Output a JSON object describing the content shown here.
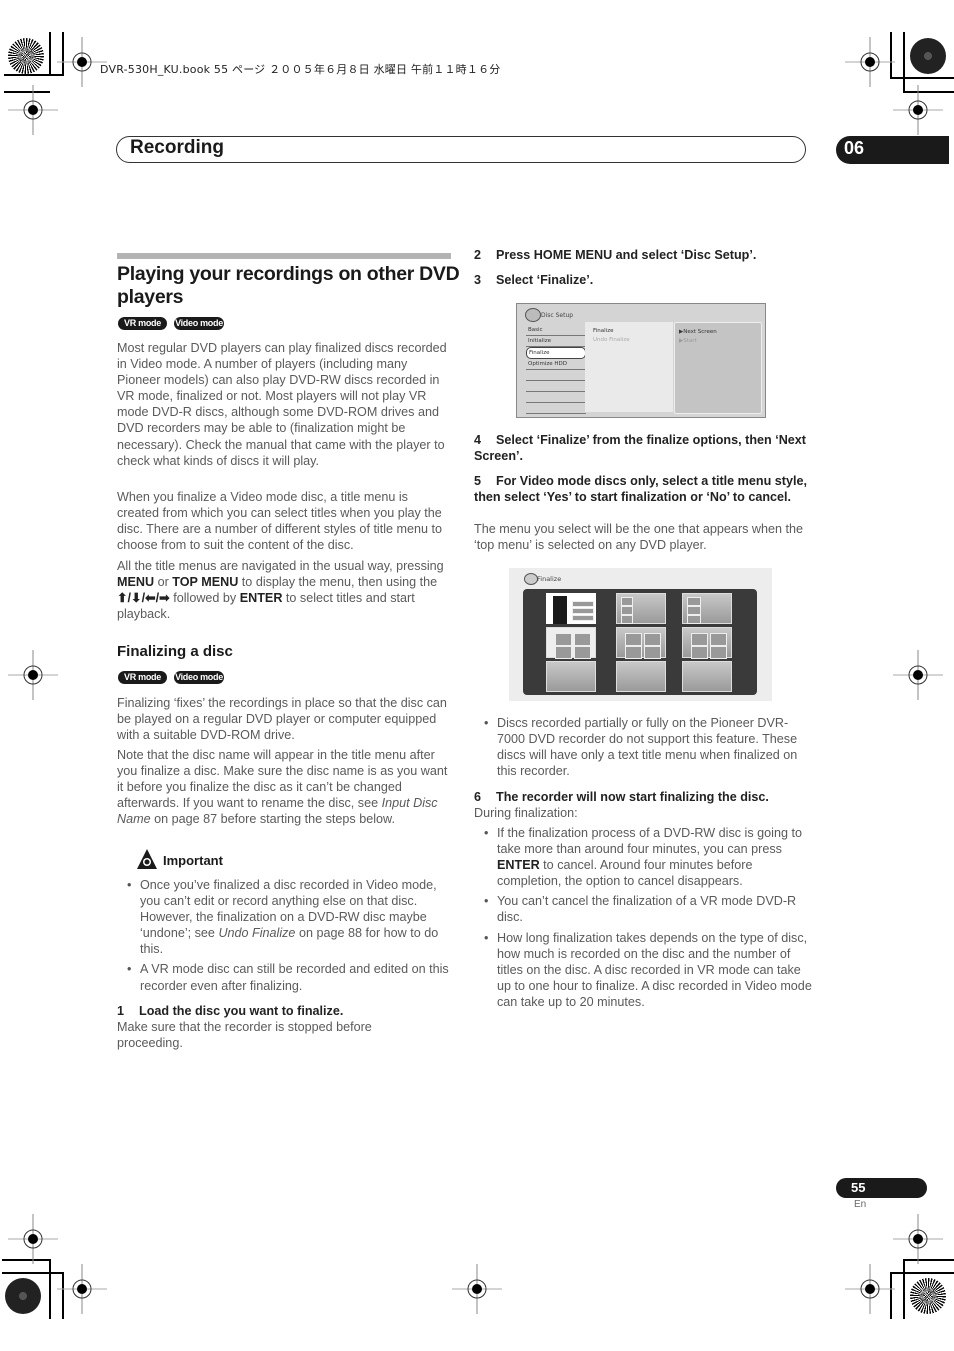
{
  "print_meta": "DVR-530H_KU.book  55 ページ  ２００５年６月８日  水曜日  午前１１時１６分",
  "header": {
    "section_title": "Recording",
    "chapter_number": "06"
  },
  "left_column": {
    "heading": "Playing your recordings on other DVD players",
    "badges": [
      "VR mode",
      "Video mode"
    ],
    "paragraphs": [
      "Most regular DVD players can play finalized discs recorded in Video mode. A number of players (including many Pioneer models) can also play DVD-RW discs recorded in VR mode, finalized or not. Most players will not play VR mode DVD-R discs, although some DVD-ROM drives and DVD recorders may be able to (finalization might be necessary). Check the manual that came with the player to check what kinds of discs it will play.",
      "When you finalize a Video mode disc, a title menu is created from which you can select titles when you play the disc. There are a number of different styles of title menu to choose from to suit the content of the disc."
    ],
    "nav_paragraph": {
      "t1": "All the title menus are navigated in the usual way, pressing ",
      "k1": "MENU",
      "t2": " or ",
      "k2": "TOP MENU",
      "t3": " to display the menu, then using the ",
      "k3": "⬆/⬇/⬅/➡",
      "t4": " followed by ",
      "k4": "ENTER",
      "t5": " to select titles and start playback."
    },
    "subheading": "Finalizing a disc",
    "sub_badges": [
      "VR mode",
      "Video mode"
    ],
    "finalize_paragraph": "Finalizing ‘fixes’ the recordings in place so that the disc can be played on a regular DVD player or computer equipped with a suitable DVD-ROM drive.",
    "note_paragraph": {
      "t1": "Note that the disc name will appear in the title menu after you finalize a disc. Make sure the disc name is as you want it before you finalize the disc as it can’t be changed afterwards. If you want to rename the disc, see ",
      "ref": "Input Disc Name",
      "t2": " on page 87 before starting the steps below."
    },
    "important": {
      "title": "Important",
      "items": [
        {
          "t1": "Once you’ve finalized a disc recorded in Video mode, you can’t edit or record anything else on that disc. However, the finalization on a DVD-RW disc maybe ‘undone’; see ",
          "ref": "Undo Finalize",
          "t2": " on page 88 for how to do this."
        },
        {
          "t1": "A VR mode disc can still be recorded and edited on this recorder even after finalizing."
        }
      ]
    },
    "step1": {
      "num": "1",
      "text": "Load the disc you want to finalize.",
      "body": "Make sure that the recorder is stopped before proceeding."
    }
  },
  "right_column": {
    "step2": {
      "num": "2",
      "text": "Press HOME MENU and select ‘Disc Setup’."
    },
    "step3": {
      "num": "3",
      "text": "Select ‘Finalize’."
    },
    "disc_setup_screen": {
      "title": "Disc Setup",
      "menu": [
        "Basic",
        "Initialize",
        "Finalize",
        "Optimize HDD",
        "",
        "",
        "",
        ""
      ],
      "selected": "Finalize",
      "options": [
        "Finalize",
        "Undo Finalize"
      ],
      "actions": [
        "▶Next Screen",
        "▶Start"
      ]
    },
    "step4": {
      "num": "4",
      "text": "Select ‘Finalize’ from the finalize options, then ‘Next Screen’."
    },
    "step5": {
      "num": "5",
      "text": "For Video mode discs only, select a title menu style, then select ‘Yes’ to start finalization or ‘No’ to cancel.",
      "body": "The menu you select will be the one that appears when the ‘top menu’ is selected on any DVD player."
    },
    "finalize_screen": {
      "title": "Finalize",
      "thumbnail_count": 9,
      "selected_index": 0
    },
    "note_bullets": [
      "Discs recorded partially or fully on the Pioneer DVR-7000 DVD recorder do not support this feature. These discs will have only a text title menu when finalized on this recorder."
    ],
    "step6": {
      "num": "6",
      "text": "The recorder will now start finalizing the disc.",
      "body": "During finalization:"
    },
    "step6_bullets": [
      {
        "t1": "If the finalization process of a DVD-RW disc is going to take more than around four minutes, you can press ",
        "k": "ENTER",
        "t2": " to cancel. Around four minutes before completion, the option to cancel disappears."
      },
      {
        "t1": "You can’t cancel the finalization of a VR mode DVD-R disc."
      },
      {
        "t1": "How long finalization takes depends on the type of disc, how much is recorded on the disc and the number of titles on the disc. A disc recorded in VR mode can take up to one hour to finalize. A disc recorded in Video mode can take up to 20 minutes."
      }
    ]
  },
  "footer": {
    "page_number": "55",
    "language": "En"
  }
}
